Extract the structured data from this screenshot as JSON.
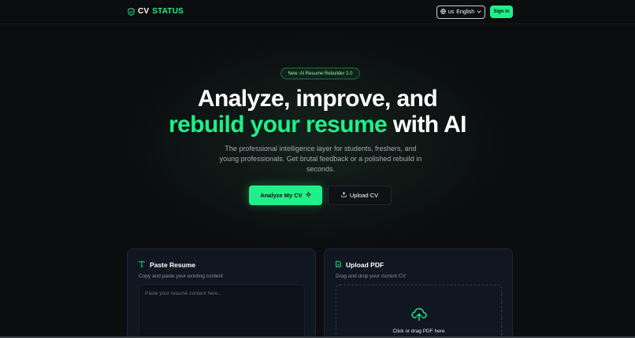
{
  "header": {
    "brand_cv": "CV",
    "brand_status": "STATUS",
    "lang_flag": "us",
    "lang_label": "English",
    "signin_label": "Sign in"
  },
  "hero": {
    "badge": "New: AI Resume Rebuilder 2.0",
    "title_line1": "Analyze, improve, and",
    "title_accent": "rebuild your resume",
    "title_rest": " with AI",
    "subtitle": "The professional intelligence layer for students, freshers, and young professionals. Get brutal feedback or a polished rebuild in seconds.",
    "primary_cta": "Analyze My CV",
    "secondary_cta": "Upload CV"
  },
  "paste_card": {
    "title": "Paste Resume",
    "subtitle": "Copy and paste your existing content",
    "placeholder": "Paste your resume content here..."
  },
  "upload_card": {
    "title": "Upload PDF",
    "subtitle": "Drag and drop your current CV",
    "drop_text": "Click or drag PDF here"
  },
  "icons": {
    "logo": "shield-check-icon",
    "lang": "globe-icon",
    "lang_caret": "chevron-down-icon",
    "primary_cta": "sparkle-icon",
    "secondary_cta": "upload-icon",
    "paste": "text-icon",
    "pdf": "file-icon",
    "dropzone": "cloud-upload-icon"
  },
  "colors": {
    "accent": "#1ff08a",
    "background": "#0b0d0f",
    "card": "#111722"
  }
}
